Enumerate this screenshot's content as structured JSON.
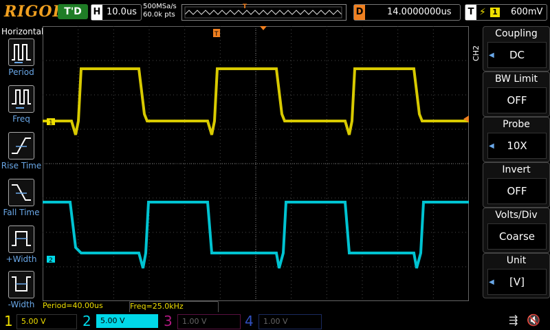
{
  "brand": "RIGOL",
  "status": {
    "trigger_state": "T'D"
  },
  "horizontal": {
    "label": "H",
    "timebase": "10.0us"
  },
  "acquisition": {
    "sample_rate": "500MSa/s",
    "points": "60.0k pts"
  },
  "delay": {
    "label": "D",
    "value": "14.0000000us"
  },
  "trigger": {
    "label": "T",
    "source": "1",
    "level": "600mV",
    "slope_glyph": "⚡"
  },
  "left_menu": {
    "title": "Horizontal",
    "items": [
      {
        "label": "Period",
        "icon": "period-measure-icon"
      },
      {
        "label": "Freq",
        "icon": "frequency-measure-icon"
      },
      {
        "label": "Rise Time",
        "icon": "rise-time-icon"
      },
      {
        "label": "Fall Time",
        "icon": "fall-time-icon"
      },
      {
        "label": "+Width",
        "icon": "positive-width-icon"
      },
      {
        "label": "-Width",
        "icon": "negative-width-icon"
      }
    ]
  },
  "right_menu": {
    "channel_tag": "CH2",
    "items": [
      {
        "title": "Coupling",
        "value": "DC",
        "has_arrow": true
      },
      {
        "title": "BW Limit",
        "value": "OFF",
        "has_arrow": false
      },
      {
        "title": "Probe",
        "value": "10X",
        "has_arrow": true
      },
      {
        "title": "Invert",
        "value": "OFF",
        "has_arrow": false
      },
      {
        "title": "Volts/Div",
        "value": "Coarse",
        "has_arrow": false
      },
      {
        "title": "Unit",
        "value": "[V]",
        "has_arrow": true
      }
    ]
  },
  "measurements": {
    "period": "Period=40.00us",
    "freq": "Freq=25.0kHz"
  },
  "channels": [
    {
      "num": "1",
      "scale": "5.00 V",
      "color": "#f0e000",
      "active": true
    },
    {
      "num": "2",
      "scale": "5.00 V",
      "color": "#00d8e8",
      "active": true
    },
    {
      "num": "3",
      "scale": "1.00 V",
      "color": "#b01880",
      "active": false
    },
    {
      "num": "4",
      "scale": "1.00 V",
      "color": "#3050c0",
      "active": false
    }
  ],
  "markers": {
    "ch1": "1",
    "ch2": "2",
    "trigger_pos": "T"
  },
  "colors": {
    "ch1": "#f0e000",
    "ch2": "#00d8e8",
    "accent": "#f08020",
    "grid": "#4a4a4a"
  }
}
